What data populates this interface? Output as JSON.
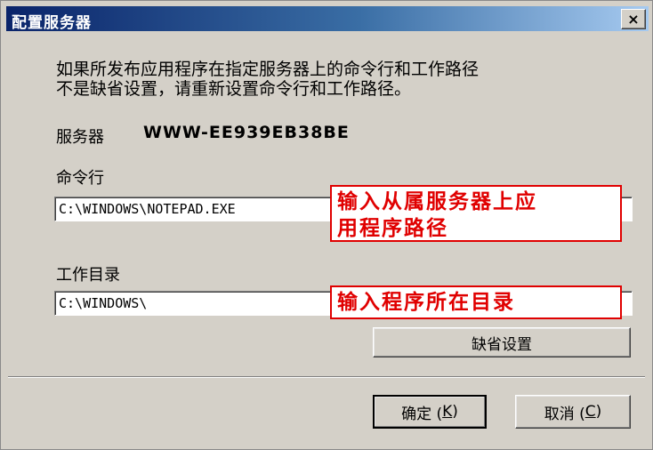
{
  "window": {
    "title": "配置服务器",
    "close_symbol": "×"
  },
  "description": {
    "line1": "如果所发布应用程序在指定服务器上的命令行和工作路径",
    "line2": "不是缺省设置，请重新设置命令行和工作路径。"
  },
  "server": {
    "label": "服务器",
    "name": "WWW-EE939EB38BE"
  },
  "command_line": {
    "label": "命令行",
    "value": "C:\\WINDOWS\\NOTEPAD.EXE"
  },
  "work_dir": {
    "label": "工作目录",
    "value": "C:\\WINDOWS\\"
  },
  "annotations": {
    "cmd_line1": "输入从属服务器上应",
    "cmd_line2": "用程序路径",
    "work": "输入程序所在目录"
  },
  "buttons": {
    "default": "缺省设置",
    "ok_label": "确定 (",
    "ok_key": "K",
    "ok_close": ")",
    "cancel_label": "取消 (",
    "cancel_key": "C",
    "cancel_close": ")"
  },
  "colors": {
    "annotation": "#e00000",
    "titlebar": "#0a246a"
  }
}
